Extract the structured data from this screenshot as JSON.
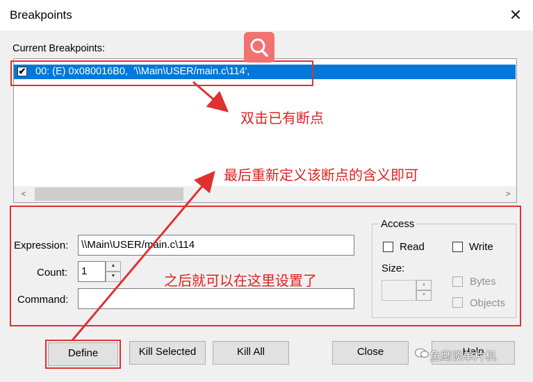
{
  "window": {
    "title": "Breakpoints",
    "close_glyph": "✕"
  },
  "current_breakpoints": {
    "label": "Current Breakpoints:",
    "items": [
      {
        "checked": true,
        "text": "00: (E) 0x080016B0,  '\\\\Main\\USER/main.c\\114',"
      }
    ]
  },
  "scroll": {
    "left_arrow": "<",
    "right_arrow": ">"
  },
  "form": {
    "expression_label": "Expression:",
    "expression_value": "\\\\Main\\USER/main.c\\114",
    "count_label": "Count:",
    "count_value": "1",
    "command_label": "Command:",
    "command_value": ""
  },
  "access": {
    "legend": "Access",
    "read_label": "Read",
    "write_label": "Write",
    "size_label": "Size:",
    "bytes_label": "Bytes",
    "objects_label": "Objects"
  },
  "buttons": {
    "define": "Define",
    "kill_selected": "Kill Selected",
    "kill_all": "Kill All",
    "close": "Close",
    "help": "Help"
  },
  "annotations": {
    "note_double_click": "双击已有断点",
    "note_redefine": "最后重新定义该断点的含义即可",
    "note_set_here": "之后就可以在这里设置了"
  },
  "watermark": {
    "text": "鱼鹰谈单片机"
  },
  "colors": {
    "selection": "#0078d7",
    "annotation_red": "#e03030",
    "badge": "#f27272"
  }
}
